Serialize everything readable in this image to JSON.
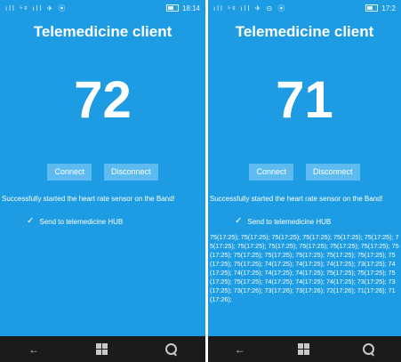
{
  "left": {
    "status": {
      "left_icons": "ıll ⁵ᵍ ıll ✈ ⦿",
      "time": "18:14"
    },
    "title": "Telemedicine client",
    "heart_rate": "72",
    "connect_label": "Connect",
    "disconnect_label": "Disconnect",
    "status_message": "Successfully started the heart rate sensor on the Band!",
    "send_label": "Send to telemedicine HUB"
  },
  "right": {
    "status": {
      "left_icons": "ıll ⁵ᵍ ıll ✈ ⊙ ⦿",
      "time": "17:2"
    },
    "title": "Telemedicine client",
    "heart_rate": "71",
    "connect_label": "Connect",
    "disconnect_label": "Disconnect",
    "status_message": "Successfully started the heart rate sensor on the Band!",
    "send_label": "Send to telemedicine HUB",
    "log": "75(17:25); 75(17:25); 75(17:25); 75(17:25); 75(17:25); 75(17:25); 75(17:25); 75(17:25); 75(17:25); 75(17:25); 75(17:25); 75(17:25); 75(17:25); 75(17:25); 75(17:25); 75(17:25); 75(17:25); 75(17:25); 75(17:25); 75(17:25); 74(17:25); 74(17:25); 74(17:25); 73(17:25); 74(17:25); 74(17:25); 74(17:25); 74(17:25); 75(17:25); 75(17:25); 75(17:25); 75(17:25); 74(17:25); 74(17:25); 74(17:25); 73(17:25); 73(17:25); 73(17:26); 73(17:26); 73(17:26); 72(17:26); 71(17:26); 71(17:26);"
  },
  "nav": {
    "back": "←",
    "search": "search"
  },
  "colors": {
    "background": "#1d9ce3",
    "button": "#5ebbf0",
    "navbar": "#1b1b1b"
  }
}
